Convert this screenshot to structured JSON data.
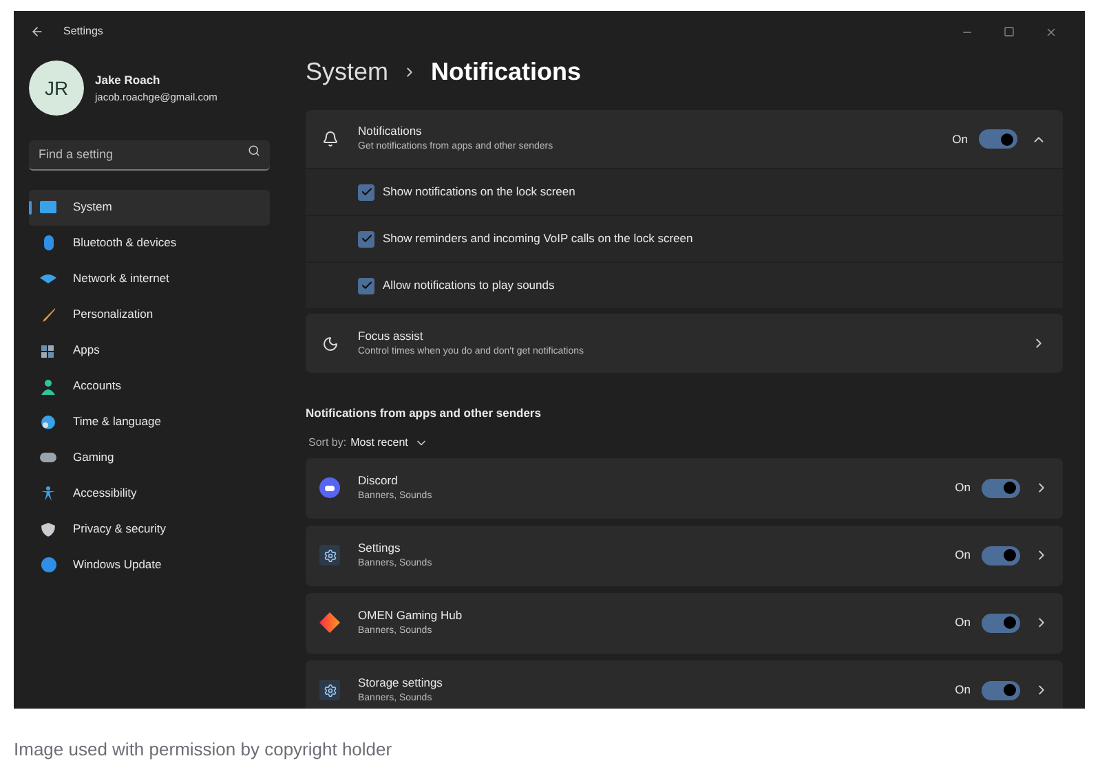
{
  "window": {
    "title": "Settings"
  },
  "user": {
    "initials": "JR",
    "name": "Jake Roach",
    "email": "jacob.roachge@gmail.com"
  },
  "search": {
    "placeholder": "Find a setting"
  },
  "nav": [
    {
      "label": "System",
      "selected": true
    },
    {
      "label": "Bluetooth & devices",
      "selected": false
    },
    {
      "label": "Network & internet",
      "selected": false
    },
    {
      "label": "Personalization",
      "selected": false
    },
    {
      "label": "Apps",
      "selected": false
    },
    {
      "label": "Accounts",
      "selected": false
    },
    {
      "label": "Time & language",
      "selected": false
    },
    {
      "label": "Gaming",
      "selected": false
    },
    {
      "label": "Accessibility",
      "selected": false
    },
    {
      "label": "Privacy & security",
      "selected": false
    },
    {
      "label": "Windows Update",
      "selected": false
    }
  ],
  "breadcrumb": [
    "System",
    "Notifications"
  ],
  "notifications": {
    "title": "Notifications",
    "subtitle": "Get notifications from apps and other senders",
    "state": "On",
    "on": true,
    "expanded": true,
    "options": [
      {
        "label": "Show notifications on the lock screen",
        "checked": true
      },
      {
        "label": "Show reminders and incoming VoIP calls on the lock screen",
        "checked": true
      },
      {
        "label": "Allow notifications to play sounds",
        "checked": true
      }
    ]
  },
  "focus_assist": {
    "title": "Focus assist",
    "subtitle": "Control times when you do and don't get notifications"
  },
  "apps_section": {
    "heading": "Notifications from apps and other senders",
    "sort_label": "Sort by:",
    "sort_value": "Most recent"
  },
  "apps": [
    {
      "kind": "discord",
      "name": "Discord",
      "detail": "Banners, Sounds",
      "state": "On",
      "on": true
    },
    {
      "kind": "gear",
      "name": "Settings",
      "detail": "Banners, Sounds",
      "state": "On",
      "on": true
    },
    {
      "kind": "diamond",
      "name": "OMEN Gaming Hub",
      "detail": "Banners, Sounds",
      "state": "On",
      "on": true
    },
    {
      "kind": "gear",
      "name": "Storage settings",
      "detail": "Banners, Sounds",
      "state": "On",
      "on": true
    }
  ],
  "caption": "Image used with permission by copyright holder"
}
